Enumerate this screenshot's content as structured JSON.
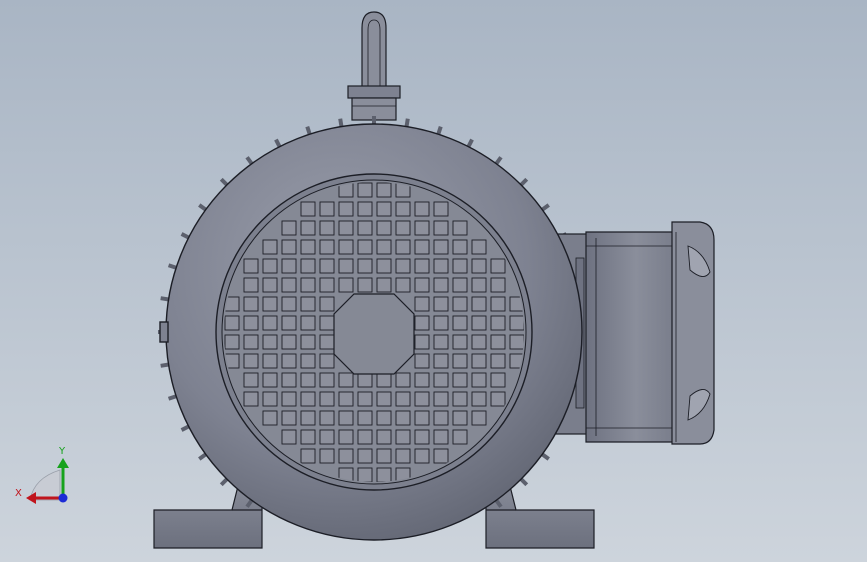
{
  "viewport": {
    "background_top": "#a9b5c4",
    "background_bottom": "#cdd4dc"
  },
  "model": {
    "body_color": "#7e8291",
    "body_highlight": "#9a9eab",
    "edge_color": "#1c1e26",
    "grille_cell_color": "#8d909c"
  },
  "triad": {
    "x_label": "X",
    "y_label": "Y",
    "x_color": "#c0141c",
    "y_color": "#16a21c",
    "z_color": "#1c2bd6"
  }
}
